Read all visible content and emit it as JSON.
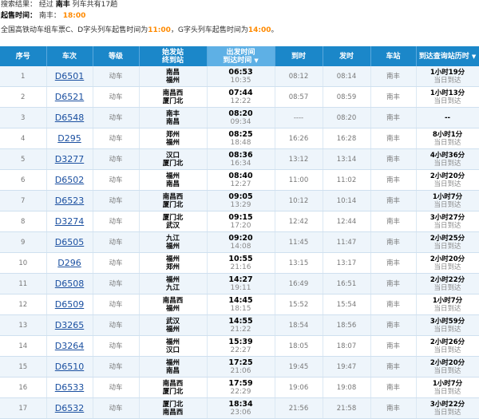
{
  "search": {
    "label": "搜索结果：",
    "via_prefix": "经过",
    "station": "南丰",
    "count_text": "列车共有17趟"
  },
  "presale": {
    "label": "起售时间：",
    "station": "南丰：",
    "time": "18:00"
  },
  "notice": {
    "part1": "全国高铁动车组车票C、D字头列车起售时间为",
    "time1": "11:00",
    "part2": "，G字头列车起售时间为",
    "time2": "14:00",
    "part3": "。"
  },
  "table": {
    "headers": {
      "seq": "序号",
      "train": "车次",
      "grade": "等级",
      "from_label": "始发站",
      "to_label": "终到站",
      "dep_label": "出发时间",
      "arr_label": "到达时间",
      "arrive": "到时",
      "depart": "发时",
      "station": "车站",
      "duration": "到达查询站历时",
      "sort_arrow": "▼"
    },
    "rows": [
      {
        "seq": "1",
        "train": "D6501",
        "grade": "动车",
        "from": "南昌",
        "to": "福州",
        "dep": "06:53",
        "arr": "10:35",
        "arrive": "08:12",
        "depart": "08:14",
        "station": "南丰",
        "dur": "1小时19分",
        "note": "当日到达"
      },
      {
        "seq": "2",
        "train": "D6521",
        "grade": "动车",
        "from": "南昌西",
        "to": "厦门北",
        "dep": "07:44",
        "arr": "12:22",
        "arrive": "08:57",
        "depart": "08:59",
        "station": "南丰",
        "dur": "1小时13分",
        "note": "当日到达"
      },
      {
        "seq": "3",
        "train": "D6548",
        "grade": "动车",
        "from": "南丰",
        "to": "南昌",
        "dep": "08:20",
        "arr": "09:34",
        "arrive": "----",
        "depart": "08:20",
        "station": "南丰",
        "dur": "--",
        "note": ""
      },
      {
        "seq": "4",
        "train": "D295",
        "grade": "动车",
        "from": "郑州",
        "to": "福州",
        "dep": "08:25",
        "arr": "18:48",
        "arrive": "16:26",
        "depart": "16:28",
        "station": "南丰",
        "dur": "8小时1分",
        "note": "当日到达"
      },
      {
        "seq": "5",
        "train": "D3277",
        "grade": "动车",
        "from": "汉口",
        "to": "厦门北",
        "dep": "08:36",
        "arr": "16:34",
        "arrive": "13:12",
        "depart": "13:14",
        "station": "南丰",
        "dur": "4小时36分",
        "note": "当日到达"
      },
      {
        "seq": "6",
        "train": "D6502",
        "grade": "动车",
        "from": "福州",
        "to": "南昌",
        "dep": "08:40",
        "arr": "12:27",
        "arrive": "11:00",
        "depart": "11:02",
        "station": "南丰",
        "dur": "2小时20分",
        "note": "当日到达"
      },
      {
        "seq": "7",
        "train": "D6523",
        "grade": "动车",
        "from": "南昌西",
        "to": "厦门北",
        "dep": "09:05",
        "arr": "13:29",
        "arrive": "10:12",
        "depart": "10:14",
        "station": "南丰",
        "dur": "1小时7分",
        "note": "当日到达"
      },
      {
        "seq": "8",
        "train": "D3274",
        "grade": "动车",
        "from": "厦门北",
        "to": "武汉",
        "dep": "09:15",
        "arr": "17:20",
        "arrive": "12:42",
        "depart": "12:44",
        "station": "南丰",
        "dur": "3小时27分",
        "note": "当日到达"
      },
      {
        "seq": "9",
        "train": "D6505",
        "grade": "动车",
        "from": "九江",
        "to": "福州",
        "dep": "09:20",
        "arr": "14:08",
        "arrive": "11:45",
        "depart": "11:47",
        "station": "南丰",
        "dur": "2小时25分",
        "note": "当日到达"
      },
      {
        "seq": "10",
        "train": "D296",
        "grade": "动车",
        "from": "福州",
        "to": "郑州",
        "dep": "10:55",
        "arr": "21:16",
        "arrive": "13:15",
        "depart": "13:17",
        "station": "南丰",
        "dur": "2小时20分",
        "note": "当日到达"
      },
      {
        "seq": "11",
        "train": "D6508",
        "grade": "动车",
        "from": "福州",
        "to": "九江",
        "dep": "14:27",
        "arr": "19:11",
        "arrive": "16:49",
        "depart": "16:51",
        "station": "南丰",
        "dur": "2小时22分",
        "note": "当日到达"
      },
      {
        "seq": "12",
        "train": "D6509",
        "grade": "动车",
        "from": "南昌西",
        "to": "福州",
        "dep": "14:45",
        "arr": "18:15",
        "arrive": "15:52",
        "depart": "15:54",
        "station": "南丰",
        "dur": "1小时7分",
        "note": "当日到达"
      },
      {
        "seq": "13",
        "train": "D3265",
        "grade": "动车",
        "from": "武汉",
        "to": "福州",
        "dep": "14:55",
        "arr": "21:22",
        "arrive": "18:54",
        "depart": "18:56",
        "station": "南丰",
        "dur": "3小时59分",
        "note": "当日到达"
      },
      {
        "seq": "14",
        "train": "D3264",
        "grade": "动车",
        "from": "福州",
        "to": "汉口",
        "dep": "15:39",
        "arr": "22:27",
        "arrive": "18:05",
        "depart": "18:07",
        "station": "南丰",
        "dur": "2小时26分",
        "note": "当日到达"
      },
      {
        "seq": "15",
        "train": "D6510",
        "grade": "动车",
        "from": "福州",
        "to": "南昌",
        "dep": "17:25",
        "arr": "21:06",
        "arrive": "19:45",
        "depart": "19:47",
        "station": "南丰",
        "dur": "2小时20分",
        "note": "当日到达"
      },
      {
        "seq": "16",
        "train": "D6533",
        "grade": "动车",
        "from": "南昌西",
        "to": "厦门北",
        "dep": "17:59",
        "arr": "22:29",
        "arrive": "19:06",
        "depart": "19:08",
        "station": "南丰",
        "dur": "1小时7分",
        "note": "当日到达"
      },
      {
        "seq": "17",
        "train": "D6532",
        "grade": "动车",
        "from": "厦门北",
        "to": "南昌西",
        "dep": "18:34",
        "arr": "23:06",
        "arrive": "21:56",
        "depart": "21:58",
        "station": "南丰",
        "dur": "3小时22分",
        "note": "当日到达"
      }
    ]
  }
}
